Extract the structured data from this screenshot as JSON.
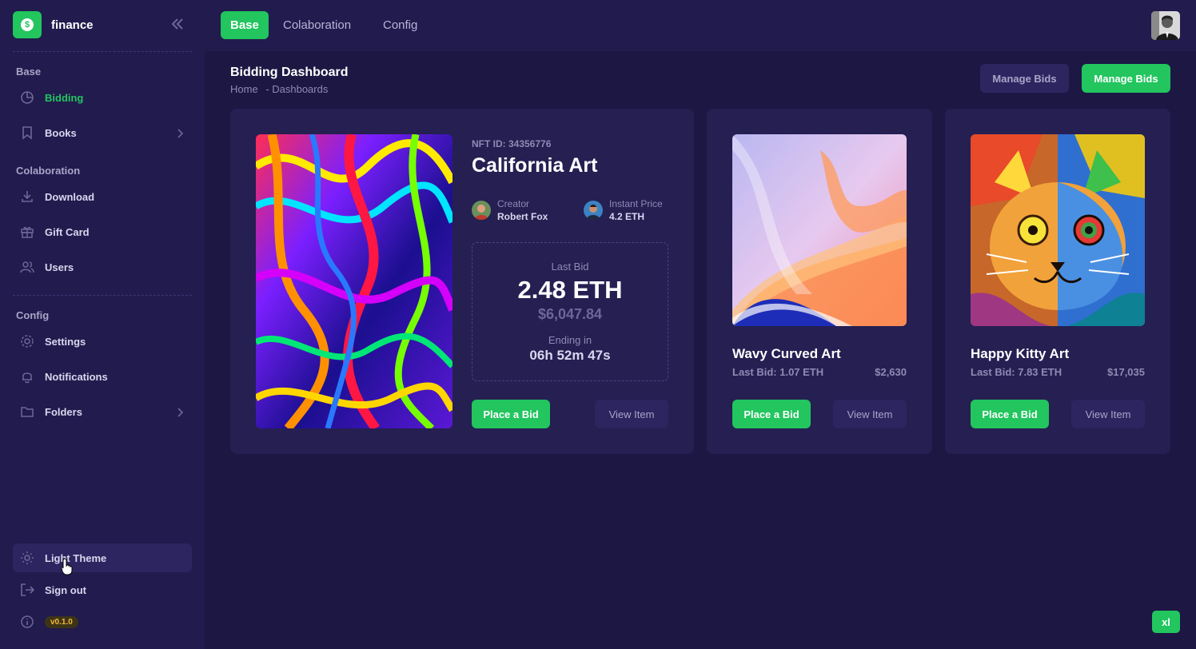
{
  "brand": {
    "name": "finance",
    "logo_icon": "dollar-coin-icon",
    "accent": "#22c55e"
  },
  "sidebar": {
    "sections": [
      {
        "label": "Base",
        "items": [
          {
            "label": "Bidding",
            "icon": "pie-chart-icon",
            "active": true
          },
          {
            "label": "Books",
            "icon": "bookmark-icon",
            "has_children": true
          }
        ]
      },
      {
        "label": "Colaboration",
        "items": [
          {
            "label": "Download",
            "icon": "download-icon"
          },
          {
            "label": "Gift Card",
            "icon": "gift-icon"
          },
          {
            "label": "Users",
            "icon": "users-icon"
          }
        ]
      },
      {
        "label": "Config",
        "items": [
          {
            "label": "Settings",
            "icon": "gear-icon"
          },
          {
            "label": "Notifications",
            "icon": "bell-icon"
          },
          {
            "label": "Folders",
            "icon": "folder-icon",
            "has_children": true
          }
        ]
      }
    ],
    "footer": {
      "theme_label": "Light Theme",
      "signout_label": "Sign out",
      "version": "v0.1.0"
    }
  },
  "topbar": {
    "tabs": [
      "Base",
      "Colaboration",
      "Config"
    ],
    "active_tab": "Base"
  },
  "page": {
    "title": "Bidding Dashboard",
    "breadcrumb": {
      "home": "Home",
      "current": "- Dashboards"
    },
    "actions": {
      "secondary": "Manage Bids",
      "primary": "Manage Bids"
    }
  },
  "featured": {
    "nft_id": "NFT ID: 34356776",
    "title": "California Art",
    "creator_label": "Creator",
    "creator_name": "Robert Fox",
    "price_label": "Instant Price",
    "price_value": "4.2 ETH",
    "last_bid_label": "Last Bid",
    "last_bid_eth": "2.48 ETH",
    "last_bid_usd": "$6,047.84",
    "ending_label": "Ending in",
    "ending_time": "06h 52m 47s",
    "bid_button": "Place a Bid",
    "view_button": "View Item"
  },
  "cards": [
    {
      "title": "Wavy Curved Art",
      "last_bid": "Last Bid: 1.07 ETH",
      "usd": "$2,630",
      "bid_button": "Place a Bid",
      "view_button": "View Item"
    },
    {
      "title": "Happy Kitty Art",
      "last_bid": "Last Bid: 7.83 ETH",
      "usd": "$17,035",
      "bid_button": "Place a Bid",
      "view_button": "View Item"
    }
  ],
  "corner_badge": "xl"
}
